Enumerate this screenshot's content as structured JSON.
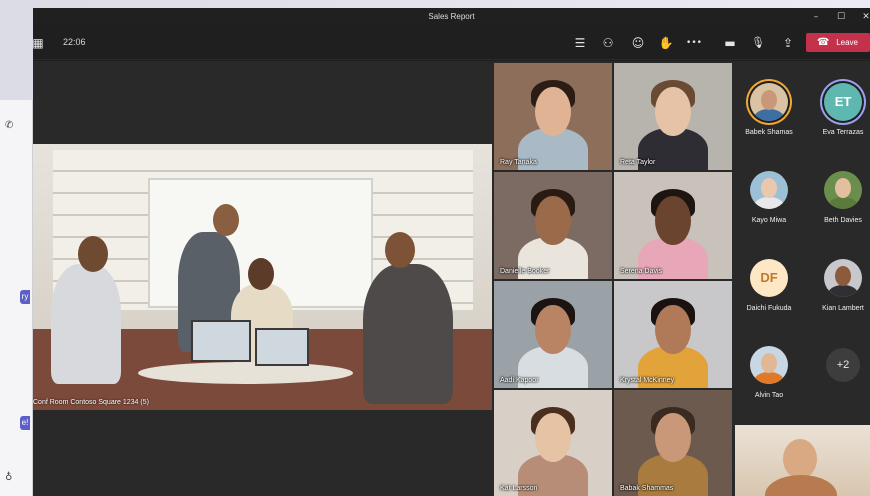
{
  "window": {
    "title": "Sales Report",
    "minimize": "–",
    "maximize": "☐",
    "close": "✕"
  },
  "toolbar": {
    "time": "22:06",
    "leave_label": "Leave"
  },
  "room": {
    "label": "Conf Room Contoso Square 1234 (5)"
  },
  "tiles": [
    {
      "name": "Ray Tanaka",
      "bg": "#8c6e5b",
      "skin": "#e0b394",
      "hair": "#2b1d15",
      "shirt": "#a9b9c6"
    },
    {
      "name": "Reta Taylor",
      "bg": "#b7b4ae",
      "skin": "#e6c3a6",
      "hair": "#6a4a32",
      "shirt": "#2d2d33"
    },
    {
      "name": "Danielle Booker",
      "bg": "#7c6b62",
      "skin": "#9b6a4a",
      "hair": "#2a1b12",
      "shirt": "#e9e4dc"
    },
    {
      "name": "Serena Davis",
      "bg": "#c9c2bb",
      "skin": "#6b4430",
      "hair": "#1e1510",
      "shirt": "#e8a7b8"
    },
    {
      "name": "Aadi Kapoor",
      "bg": "#9aa2a8",
      "skin": "#b98463",
      "hair": "#1b1410",
      "shirt": "#d8dde1"
    },
    {
      "name": "Krystal McKinney",
      "bg": "#c8c7c9",
      "skin": "#b07a58",
      "hair": "#1a1210",
      "shirt": "#e2a33a"
    },
    {
      "name": "Kat Larsson",
      "bg": "#d8d0c6",
      "skin": "#e7c3a6",
      "hair": "#4a2f1f",
      "shirt": "#b88d77"
    },
    {
      "name": "Babak Shammas",
      "bg": "#6d5a4f",
      "skin": "#c89878",
      "hair": "#3a2a20",
      "shirt": "#a97b3e"
    }
  ],
  "roster": [
    {
      "name": "Babek Shamas",
      "type": "photo",
      "skin": "#c89878",
      "shirt": "#3e6fa3",
      "bg": "#d9c3a4",
      "ring": "orange"
    },
    {
      "name": "Eva Terrazas",
      "type": "initials",
      "initials": "ET",
      "bg": "#5fb8b0",
      "fg": "#ffffff",
      "ring": "purple"
    },
    {
      "name": "Kayo Miwa",
      "type": "photo",
      "skin": "#eac8ad",
      "shirt": "#e8e8ea",
      "bg": "#9cc0d6"
    },
    {
      "name": "Beth Davies",
      "type": "photo",
      "skin": "#e3bfa0",
      "shirt": "#5c7a3c",
      "bg": "#6a8f4c"
    },
    {
      "name": "Daichi Fukuda",
      "type": "initials",
      "initials": "DF",
      "bg": "#fde7c4",
      "fg": "#c2782a"
    },
    {
      "name": "Kian Lambert",
      "type": "photo",
      "skin": "#8c5a3c",
      "shirt": "#2f2f34",
      "bg": "#c8c8cc"
    },
    {
      "name": "Alvin Tao",
      "type": "photo",
      "skin": "#e2b894",
      "shirt": "#e07a2a",
      "bg": "#c7d7e3"
    },
    {
      "name": "",
      "type": "more",
      "label": "+2"
    }
  ],
  "icons": {
    "grid": "▦",
    "chat": "☰",
    "people": "⚇",
    "reactions": "☺",
    "raise": "✋",
    "more": "•••",
    "camera": "▬",
    "mic": "🎙",
    "share": "⇪",
    "phone": "☎"
  }
}
